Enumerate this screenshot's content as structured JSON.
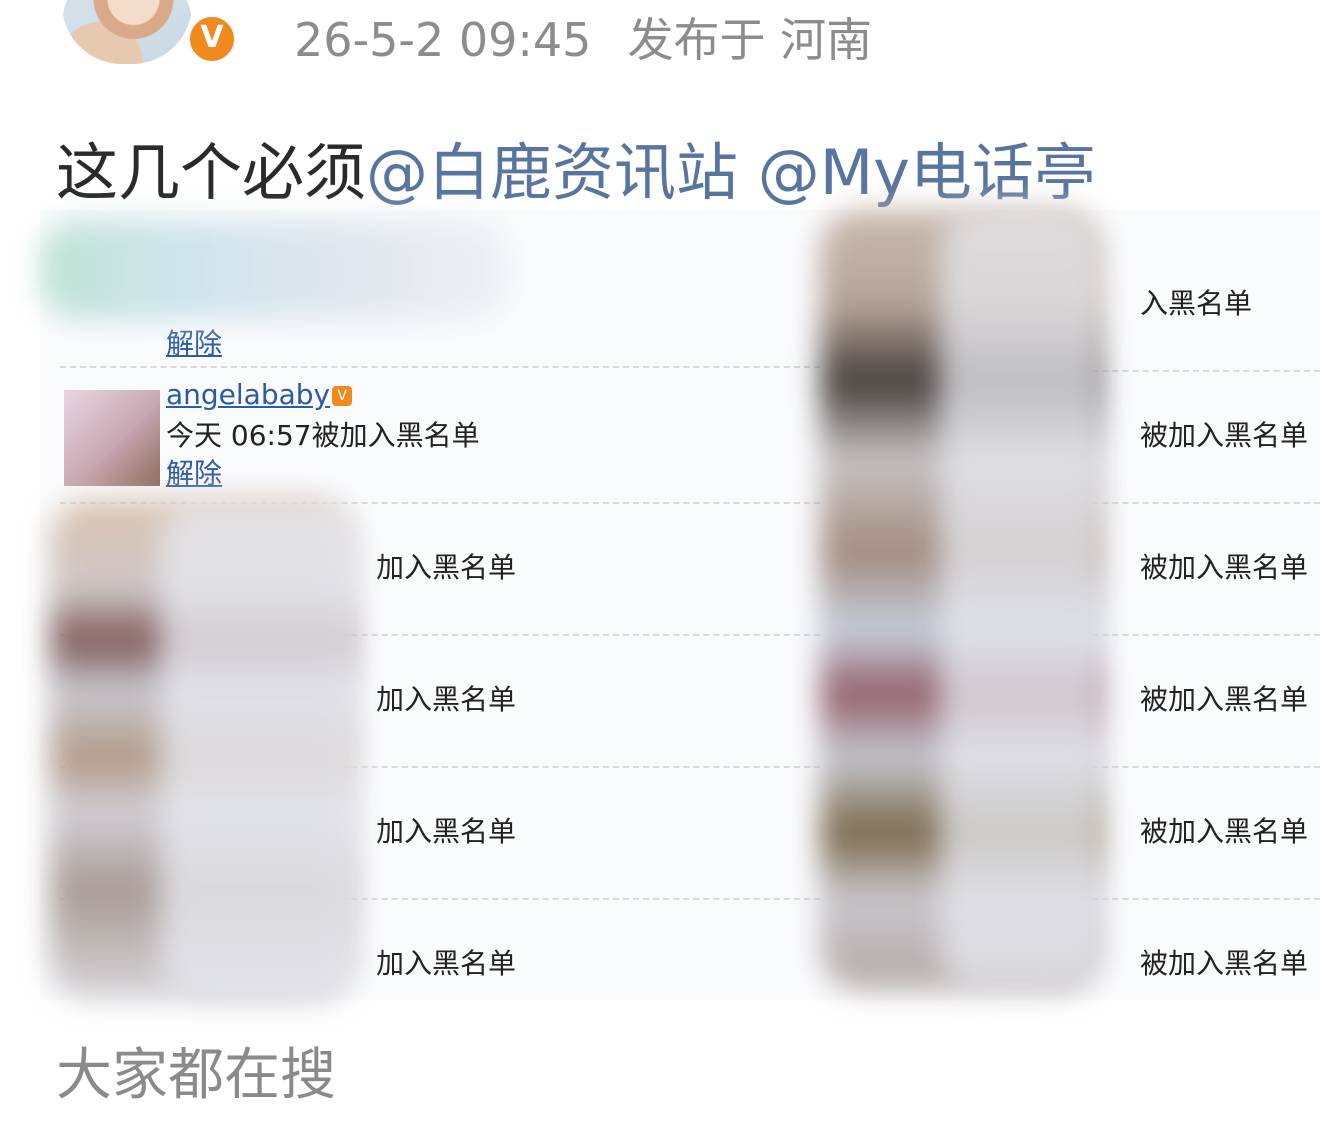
{
  "post": {
    "avatar_badge": "V",
    "timestamp": "26-5-2 09:45",
    "location": "发布于 河南",
    "text_prefix": "这几个必须",
    "mentions": [
      "@白鹿资讯站",
      "@My电话亭"
    ]
  },
  "blacklist_screenshot": {
    "left_column": [
      {
        "name": "",
        "status": "",
        "action": "解除",
        "partial": ""
      },
      {
        "name": "angelababy",
        "verified": true,
        "status": "今天 06:57被加入黑名单",
        "action": "解除",
        "partial": ""
      },
      {
        "name": "",
        "status": "",
        "action": "",
        "partial": "加入黑名单"
      },
      {
        "name": "",
        "status": "",
        "action": "",
        "partial": "加入黑名单"
      },
      {
        "name": "",
        "status": "",
        "action": "",
        "partial": "加入黑名单"
      },
      {
        "name": "",
        "status": "",
        "action": "",
        "partial": "加入黑名单"
      }
    ],
    "right_column": [
      {
        "partial": "入黑名单"
      },
      {
        "partial": "被加入黑名单"
      },
      {
        "partial": "被加入黑名单"
      },
      {
        "partial": "被加入黑名单"
      },
      {
        "partial": "被加入黑名单"
      },
      {
        "partial": "被加入黑名单"
      }
    ]
  },
  "footer": {
    "trending_title": "大家都在搜"
  },
  "colors": {
    "mention": "#5874a0",
    "meta_text": "#8c8c8c",
    "badge": "#f08a1c",
    "link": "#2a5aa8"
  }
}
